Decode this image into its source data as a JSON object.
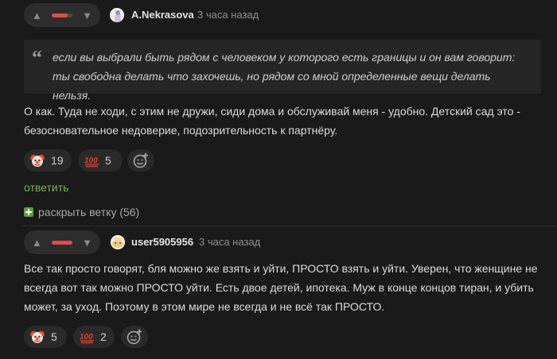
{
  "comment1": {
    "author": "A.Nekrasova",
    "time": "3 часа назад",
    "vote_rating_fraction": 0.75,
    "quote": "если вы выбрали быть рядом с человеком у которого есть границы и он вам говорит: ты свободна делать что захочешь, но рядом со мной определенные вещи делать нельзя.",
    "text": "О как. Туда не ходи, с этим не дружи, сиди дома и обслуживай меня - удобно. Детский сад это - безосновательное недоверие, подозрительность к партнёру.",
    "reactions": [
      {
        "icon": "clown-face-icon",
        "count": "19"
      },
      {
        "icon": "hundred-points-icon",
        "count": "5"
      }
    ],
    "reply_label": "ответить",
    "expand_label": "раскрыть ветку (56)"
  },
  "comment2": {
    "author": "user5905956",
    "time": "3 часа назад",
    "vote_rating_fraction": 1.0,
    "text": "Все так просто говорят, бля можно же взять и уйти, ПРОСТО взять и уйти. Уверен, что женщине не всегда вот так можно ПРОСТО уйти. Есть двое детей, ипотека. Муж в конце концов тиран, и убить может, за уход. Поэтому в этом мире не всегда и не всё так ПРОСТО.",
    "reactions": [
      {
        "icon": "clown-face-icon",
        "count": "5"
      },
      {
        "icon": "hundred-points-icon",
        "count": "2"
      }
    ]
  },
  "colors": {
    "background": "#1a1a1a",
    "accent_green": "#73b549",
    "vote_red": "#e2494b"
  }
}
